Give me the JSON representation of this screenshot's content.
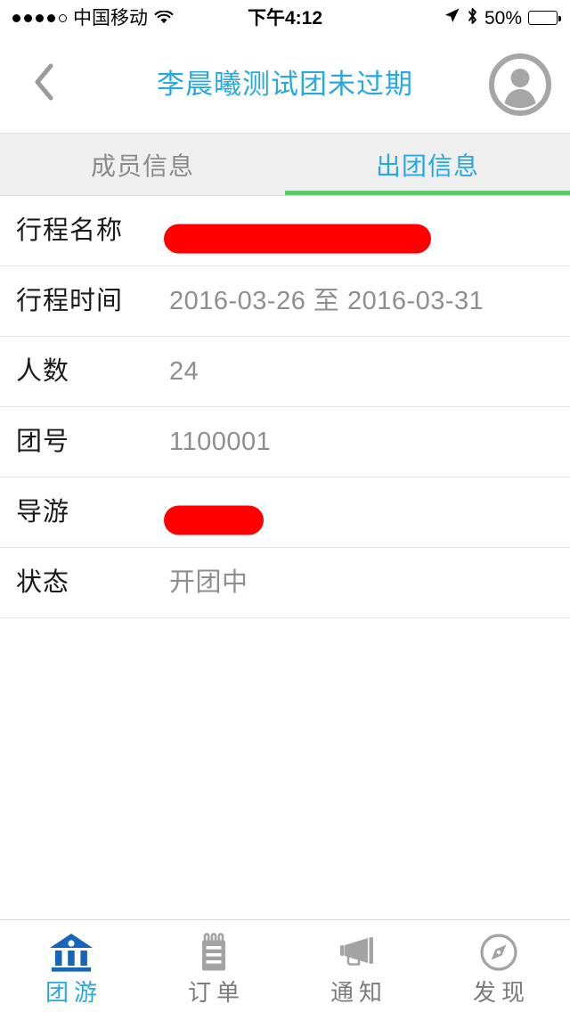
{
  "status_bar": {
    "signal_dots": [
      true,
      true,
      true,
      true,
      false
    ],
    "carrier": "中国移动",
    "wifi_icon": "wifi-icon",
    "time": "下午4:12",
    "location_icon": "location-arrow-icon",
    "bluetooth_icon": "bluetooth-icon",
    "battery_percent": "50%",
    "battery_level": 50
  },
  "nav": {
    "back_icon": "chevron-left-icon",
    "title": "李晨曦测试团未过期",
    "avatar_icon": "user-avatar-icon",
    "title_color": "#29a8e0"
  },
  "segment_tabs": {
    "active_index": 1,
    "underline_color": "#5dc96a",
    "active_color": "#29a8e0",
    "inactive_color": "#8a8a8a",
    "items": [
      {
        "label": "成员信息"
      },
      {
        "label": "出团信息"
      }
    ]
  },
  "info_list": {
    "rows": [
      {
        "label": "行程名称",
        "value": "",
        "redacted": true,
        "redact_width": 300,
        "redact_color": "#ff0000"
      },
      {
        "label": "行程时间",
        "value": "2016-03-26 至 2016-03-31",
        "redacted": false
      },
      {
        "label": "人数",
        "value": "24",
        "redacted": false
      },
      {
        "label": "团号",
        "value": "1100001",
        "redacted": false
      },
      {
        "label": "导游",
        "value": "",
        "redacted": true,
        "redact_width": 112,
        "redact_color": "#ff0000"
      },
      {
        "label": "状态",
        "value": "开团中",
        "redacted": false
      }
    ]
  },
  "bottom_tabs": {
    "active_index": 0,
    "active_color": "#29a8e0",
    "inactive_color": "#9b9b9b",
    "items": [
      {
        "label": "团游",
        "icon": "bank-building-icon"
      },
      {
        "label": "订单",
        "icon": "notepad-icon"
      },
      {
        "label": "通知",
        "icon": "megaphone-icon"
      },
      {
        "label": "发现",
        "icon": "compass-icon"
      }
    ]
  }
}
